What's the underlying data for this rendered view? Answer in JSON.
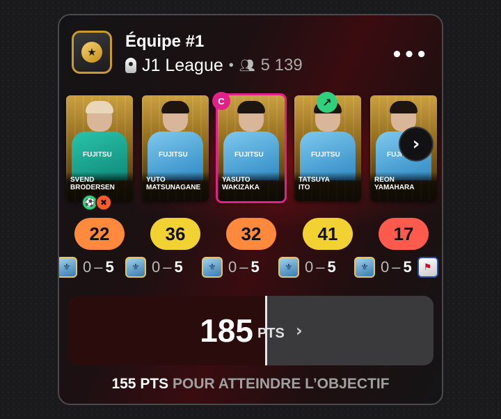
{
  "header": {
    "title": "Équipe #1",
    "league": "J1 League",
    "separator": "•",
    "followers": "5 139",
    "more_label": "•••"
  },
  "players": [
    {
      "name_line1": "SVEND",
      "name_line2": "BRODERSEN",
      "score": "22",
      "score_color": "#ff8a3d",
      "opponent_score": "0 – 5"
    },
    {
      "name_line1": "YUTO",
      "name_line2": "MATSUNAGANE",
      "score": "36",
      "score_color": "#f2d232",
      "opponent_score": "0 – 5"
    },
    {
      "name_line1": "YASUTO",
      "name_line2": "WAKIZAKA",
      "score": "32",
      "score_color": "#ff8a3d",
      "opponent_score": "0 – 5"
    },
    {
      "name_line1": "TATSUYA",
      "name_line2": "ITO",
      "score": "41",
      "score_color": "#f2d232",
      "opponent_score": "0 – 5"
    },
    {
      "name_line1": "REON",
      "name_line2": "YAMAHARA",
      "score": "17",
      "score_color": "#ff5a4e",
      "opponent_score": "0 – 5"
    }
  ],
  "captain_label": "C",
  "sponsor": "FUJITSU",
  "match": {
    "home": "0",
    "sep": "–",
    "away": "5"
  },
  "total": {
    "value": "185",
    "unit": "PTS",
    "progress": 0.54
  },
  "objective": {
    "points": "155 PTS",
    "text": " POUR ATTEINDRE L’OBJECTIF"
  },
  "icons": {
    "league_badge": "star-badge-icon",
    "followers": "people-icon",
    "next": "chevron-right-icon",
    "trend": "trend-up-icon",
    "events": [
      "assist-icon",
      "foul-icon"
    ]
  }
}
